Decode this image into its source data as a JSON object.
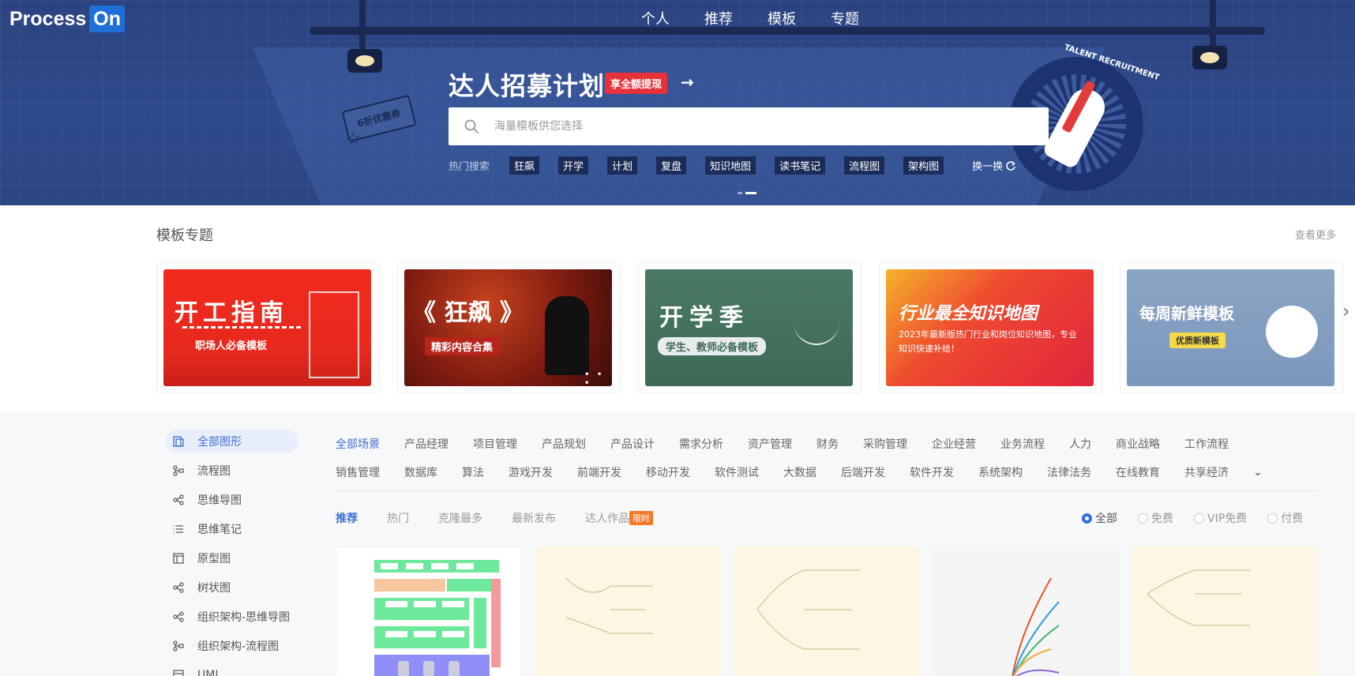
{
  "brand": {
    "name": "Process",
    "suffix": "On"
  },
  "nav": [
    "个人",
    "推荐",
    "模板",
    "专题"
  ],
  "hero": {
    "title": "达人招募计划",
    "tag": "享全额提现",
    "arrow": "→",
    "coupon": "6折优惠券",
    "badge_text": "TALENT RECRUITMENT",
    "search_placeholder": "海量模板供您选择",
    "hot_label": "热门搜索",
    "hot_tags": [
      "狂飙",
      "开学",
      "计划",
      "复盘",
      "知识地图",
      "读书笔记",
      "流程图",
      "架构图"
    ],
    "swap": "换一换"
  },
  "topics": {
    "title": "模板专题",
    "more": "查看更多",
    "cards": [
      {
        "title": "开工指南",
        "subtitle": "职场人必备模板"
      },
      {
        "title": "《 狂飙 》",
        "subtitle": "精彩内容合集"
      },
      {
        "title": "开学季",
        "subtitle": "学生、教师必备模板"
      },
      {
        "title": "行业最全知识地图",
        "subtitle": "2023年最新版热门行业和岗位知识地图，专业知识快速补给！"
      },
      {
        "title": "每周新鲜模板",
        "subtitle": "优质新模板"
      }
    ]
  },
  "sidebar": [
    "全部图形",
    "流程图",
    "思维导图",
    "思维笔记",
    "原型图",
    "树状图",
    "组织架构-思维导图",
    "组织架构-流程图",
    "UML"
  ],
  "categories_row1": [
    "全部场景",
    "产品经理",
    "项目管理",
    "产品规划",
    "产品设计",
    "需求分析",
    "资产管理",
    "财务",
    "采购管理",
    "企业经营",
    "业务流程",
    "人力",
    "商业战略",
    "工作流程"
  ],
  "categories_row2": [
    "销售管理",
    "数据库",
    "算法",
    "游戏开发",
    "前端开发",
    "移动开发",
    "软件测试",
    "大数据",
    "后端开发",
    "软件开发",
    "系统架构",
    "法律法务",
    "在线教育",
    "共享经济"
  ],
  "sort_tabs": [
    "推荐",
    "热门",
    "克隆最多",
    "最新发布",
    "达人作品"
  ],
  "limit_badge": "限时",
  "filters": [
    "全部",
    "免费",
    "VIP免费",
    "付费"
  ],
  "colors": {
    "primary": "#3a6fd8",
    "hero_bg": "#2f4a8c",
    "tag_red": "#e8323a",
    "limit_orange": "#f47a2a"
  }
}
